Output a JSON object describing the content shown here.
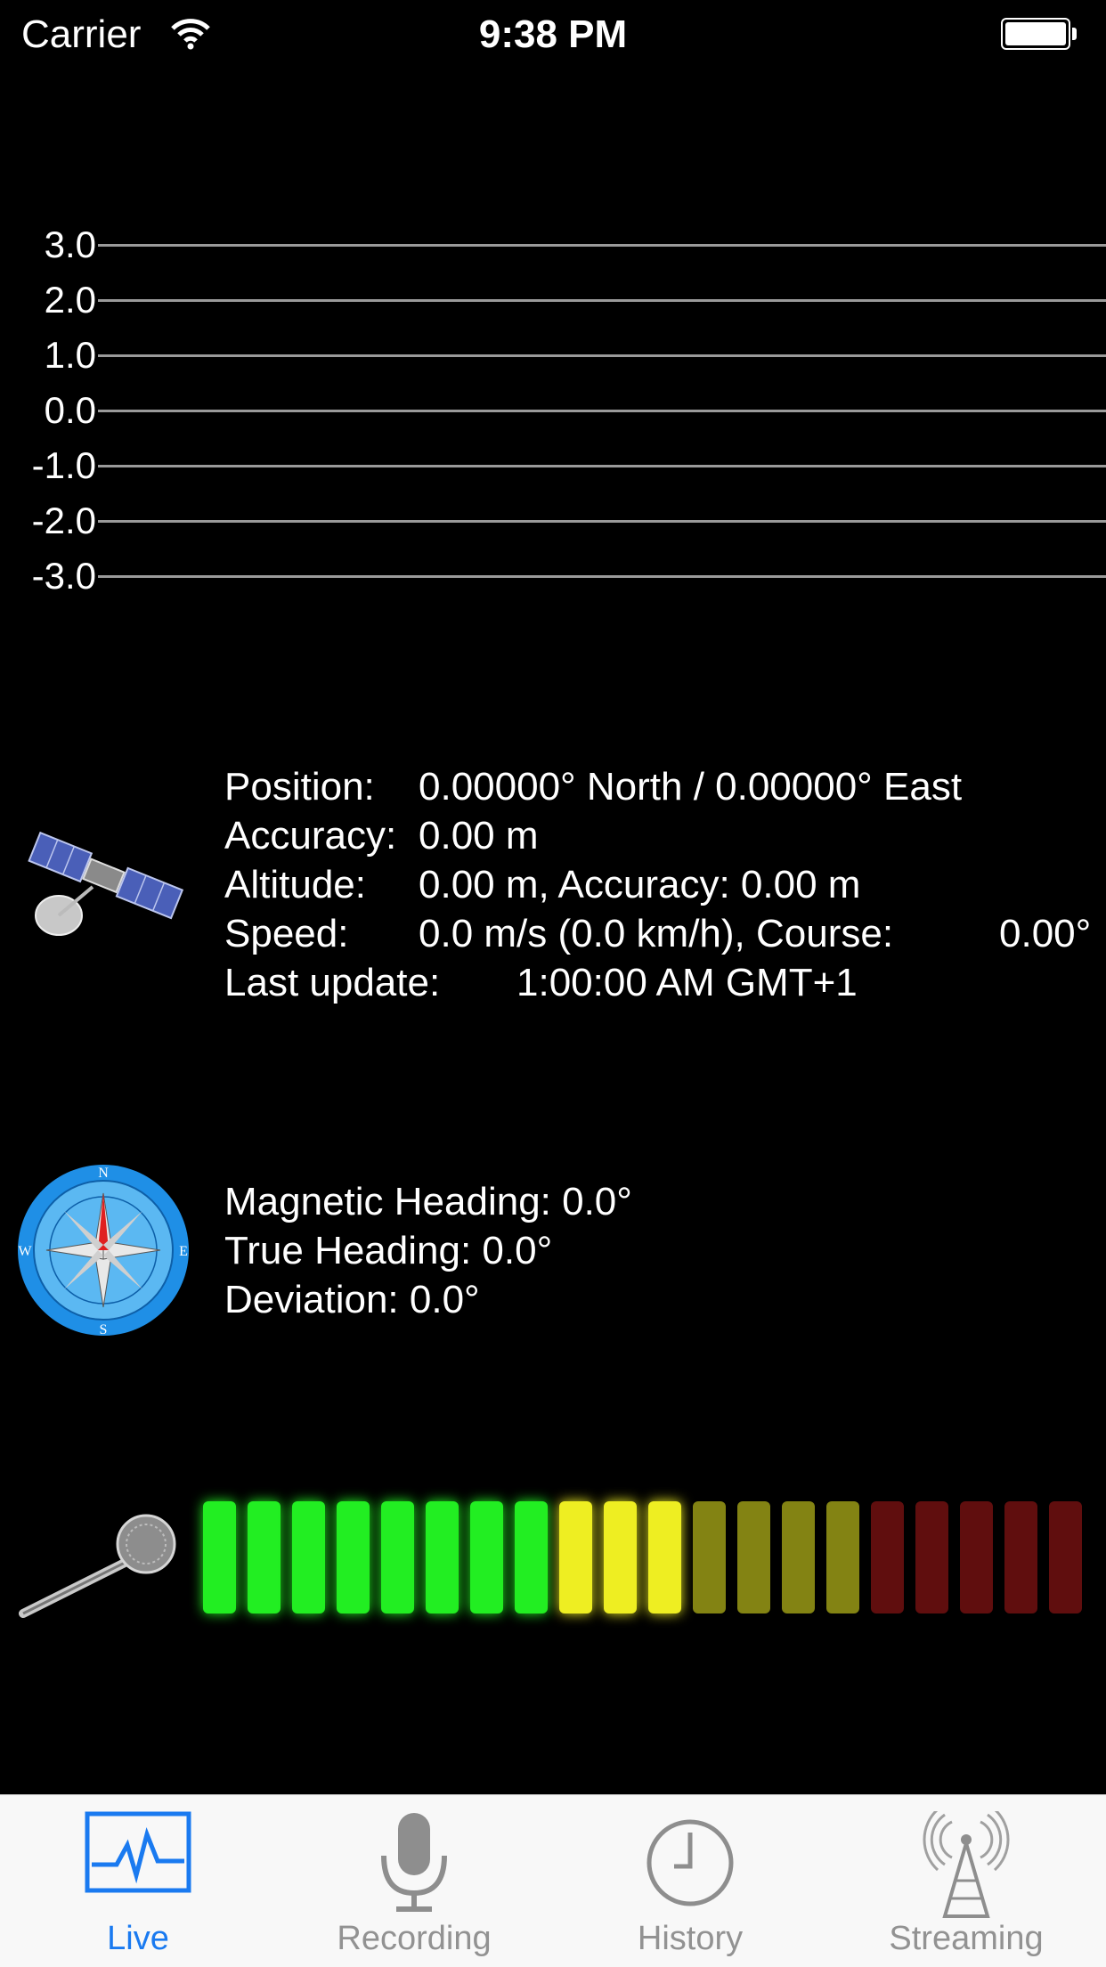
{
  "status_bar": {
    "carrier": "Carrier",
    "time": "9:38 PM"
  },
  "chart_data": {
    "type": "line",
    "title": "",
    "xlabel": "",
    "ylabel": "",
    "ylim": [
      -3.0,
      3.0
    ],
    "y_ticks": [
      "3.0",
      "2.0",
      "1.0",
      "0.0",
      "-1.0",
      "-2.0",
      "-3.0"
    ],
    "grid": true,
    "series": []
  },
  "gps": {
    "position_label": "Position:",
    "position_value": "0.00000° North / 0.00000° East",
    "accuracy_label": "Accuracy:",
    "accuracy_value": "0.00 m",
    "altitude_label": "Altitude:",
    "altitude_value": "0.00 m, Accuracy: 0.00 m",
    "speed_label": "Speed:",
    "speed_value": "0.0 m/s (0.0 km/h), Course:",
    "course_value": "0.00°",
    "update_label": "Last update:",
    "update_value": "1:00:00 AM GMT+1"
  },
  "compass": {
    "magnetic": "Magnetic Heading: 0.0°",
    "true": "True Heading: 0.0°",
    "deviation": "Deviation: 0.0°",
    "letters": {
      "n": "N",
      "e": "E",
      "s": "S",
      "w": "W"
    }
  },
  "audio_meter": {
    "segments": 20,
    "lit": 11,
    "colors": {
      "green": "#22ee22",
      "yellow": "#eeee22",
      "red": "#6a1010"
    }
  },
  "tabs": [
    {
      "label": "Live",
      "icon": "pulse-icon",
      "active": true
    },
    {
      "label": "Recording",
      "icon": "microphone-icon",
      "active": false
    },
    {
      "label": "History",
      "icon": "clock-icon",
      "active": false
    },
    {
      "label": "Streaming",
      "icon": "antenna-icon",
      "active": false
    }
  ],
  "accent_color": "#1a7af0"
}
